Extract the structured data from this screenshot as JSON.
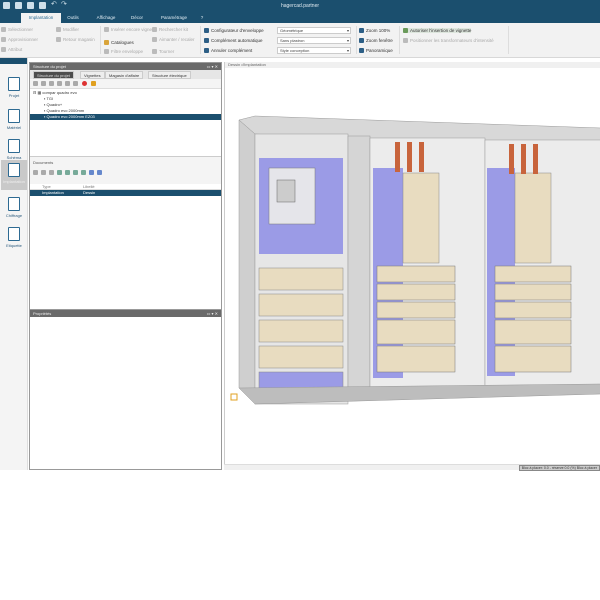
{
  "app": {
    "title": "hagercad.partner"
  },
  "quick_access": [
    "app-icon",
    "open-icon",
    "save-icon",
    "print-icon",
    "undo-icon",
    "redo-icon"
  ],
  "tabs": [
    "Implantation",
    "Outils",
    "Affichage",
    "Décor",
    "Paramétrage",
    "?"
  ],
  "active_tab": "Implantation",
  "ribbon": {
    "group1": [
      "Sélectionner",
      "Approvisionner",
      "Attribut"
    ],
    "group2": [
      "Modifier",
      "Retour magasin"
    ],
    "group3": [
      "Insérer encore vignette",
      "Catalogues",
      "Filtre enveloppe"
    ],
    "group4": [
      "Rechercher kit",
      "Aimanter / recaler",
      "Tourner"
    ],
    "group5": [
      "Configurateur d'enveloppe",
      "Complément automatique",
      "Annuler complément"
    ],
    "selects": [
      "Géométrique",
      "Sans plastron",
      "Style conception"
    ],
    "zoom": [
      "Zoom 100%",
      "Zoom fenêtre",
      "Panoramique"
    ],
    "options": [
      "Autoriser l'insertion de vignette",
      "Positionner les transformateurs d'intensité"
    ]
  },
  "sidebar": {
    "items": [
      "Projet",
      "Matériel",
      "Schéma",
      "Implantation",
      "Chiffrage",
      "Etiquette"
    ],
    "active": "Implantation"
  },
  "project_panel": {
    "title": "Structure du projet",
    "tabs": [
      "Structure du projet",
      "Vignettes",
      "Magasin d'affaire",
      "Structure électrique"
    ],
    "tree": [
      "compar quadro evo",
      "TGI",
      "Quadro+",
      "Quadro evo 2000mm",
      "Quadro evo 2000mm EZ03"
    ],
    "selected_tree_item": "Quadro evo 2000mm EZ03",
    "documents_label": "Documents",
    "doc_columns": [
      "Type",
      "Libellé"
    ],
    "doc_rows": [
      {
        "type": "Implantation",
        "label": "Dessin"
      }
    ]
  },
  "properties_panel": {
    "title": "Propriétés"
  },
  "drawing": {
    "title": "Dessin d'implantation"
  },
  "status": {
    "text": "Bloc à placer: 0.0 - réserve 0.0 (%)  Bloc à placer"
  },
  "colors": {
    "brand": "#1b4f6e",
    "cabinet_panel": "#9b9be6",
    "device": "#e8dcc0",
    "busbar": "#c8643c"
  }
}
